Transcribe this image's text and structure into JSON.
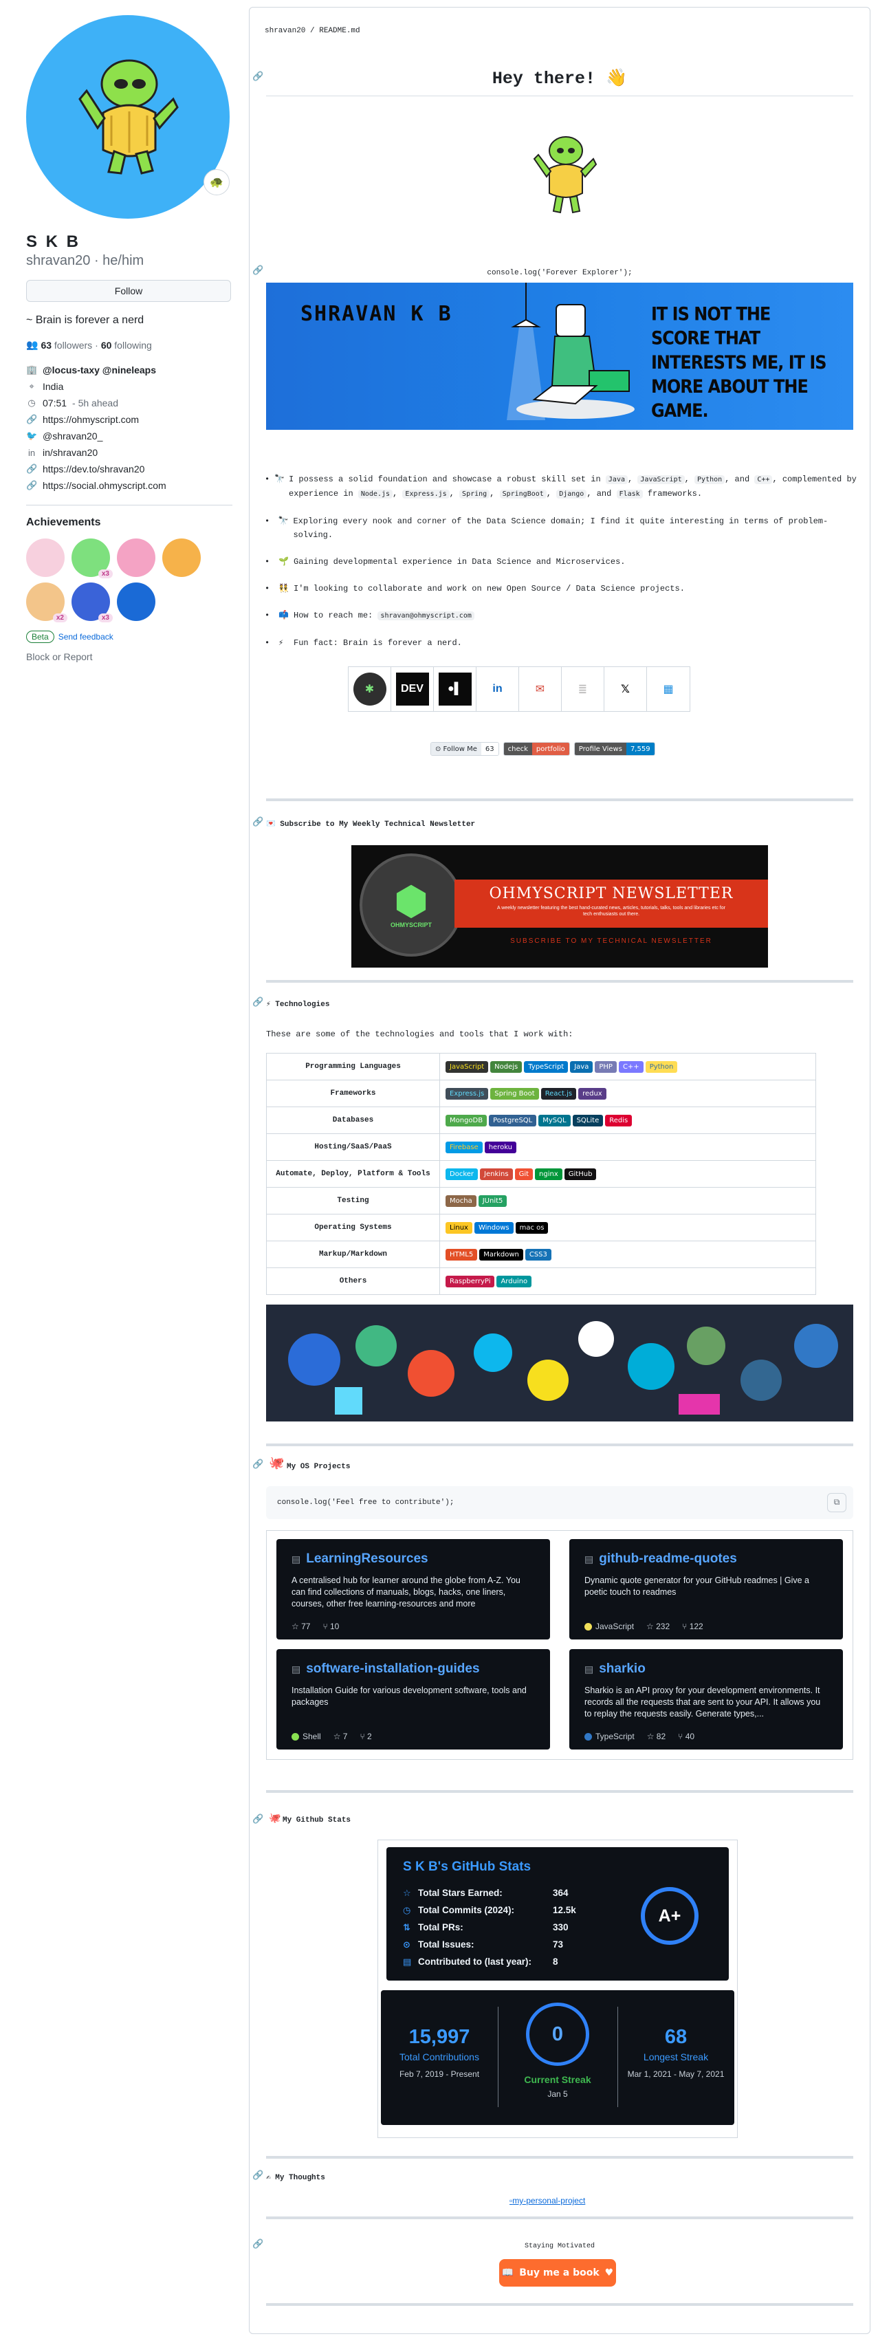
{
  "profile": {
    "fullname": "S K B",
    "handle": "shravan20",
    "pronouns": "he/him",
    "handle_line": "shravan20 · he/him",
    "status_emoji": "🐢",
    "follow_label": "Follow",
    "bio": "~ Brain is forever a nerd",
    "followers_count": "63",
    "followers_label": "followers",
    "separator": "·",
    "following_count": "60",
    "following_label": "following",
    "organizations": "@locus-taxy @nineleaps",
    "location": "India",
    "local_time": "07:51",
    "time_ahead": "- 5h ahead",
    "links": [
      {
        "icon": "link-icon",
        "text": "https://ohmyscript.com"
      },
      {
        "icon": "twitter-icon",
        "text": "@shravan20_"
      },
      {
        "icon": "linkedin-icon",
        "text": "in/shravan20"
      },
      {
        "icon": "link-icon",
        "text": "https://dev.to/shravan20"
      },
      {
        "icon": "link-icon",
        "text": "https://social.ohmyscript.com"
      }
    ],
    "achievements_title": "Achievements",
    "achievements": [
      {
        "name": "heart-on-sleeve-badge",
        "color": "#f7d0de",
        "count": ""
      },
      {
        "name": "pull-shark-badge",
        "color": "#7ee07e",
        "count": "x3"
      },
      {
        "name": "yolo-badge",
        "color": "#f4a3c4",
        "count": ""
      },
      {
        "name": "quickdraw-badge",
        "color": "#f6b24a",
        "count": ""
      },
      {
        "name": "starstruck-badge",
        "color": "#f3c58a",
        "count": "x2"
      },
      {
        "name": "galaxy-brain-badge",
        "color": "#3a63d8",
        "count": "x3"
      },
      {
        "name": "arctic-code-vault-badge",
        "color": "#1a6ad6",
        "count": ""
      }
    ],
    "beta_label": "Beta",
    "feedback_label": "Send feedback",
    "block_report_label": "Block or Report"
  },
  "readme": {
    "path": "shravan20 / README.md",
    "hello_title": "Hey there! 👋",
    "console_line": "console.log('Forever Explorer');",
    "banner_name": "SHRAVAN K B",
    "banner_quote": "IT IS NOT THE SCORE THAT INTERESTS ME, IT IS MORE ABOUT THE GAME.",
    "bio_items": [
      {
        "emoji": "🔭",
        "parts": [
          "I possess a solid foundation and showcase a robust skill set in ",
          "Java",
          ", ",
          "JavaScript",
          ", ",
          "Python",
          ", and ",
          "C++",
          ", complemented by experience in ",
          "Node.js",
          ", ",
          "Express.js",
          ", ",
          "Spring",
          ", ",
          "SpringBoot",
          ", ",
          "Django",
          ", and ",
          "Flask",
          " frameworks."
        ]
      },
      {
        "emoji": "🔭",
        "text": "Exploring every nook and corner of the Data Science domain; I find it quite interesting in terms of problem-solving."
      },
      {
        "emoji": "🌱",
        "text": "Gaining developmental experience in Data Science and Microservices."
      },
      {
        "emoji": "👯",
        "text": "I'm looking to collaborate and work on new Open Source / Data Science projects."
      },
      {
        "emoji": "📫",
        "text": "How to reach me: ",
        "code": "shravan@ohmyscript.com"
      },
      {
        "emoji": "⚡",
        "text": "Fun fact: Brain is forever a nerd."
      }
    ],
    "social_icons": [
      {
        "name": "ohmyscript-icon",
        "label": "",
        "bg": "#2f2f2f",
        "fg": "#7be37b"
      },
      {
        "name": "dev-icon",
        "label": "DEV",
        "bg": "#0a0a0a",
        "fg": "#ffffff"
      },
      {
        "name": "medium-icon",
        "label": "●▌",
        "bg": "#0a0a0a",
        "fg": "#ffffff"
      },
      {
        "name": "linkedin-icon",
        "label": "in",
        "bg": "#ffffff",
        "fg": "#0a66c2"
      },
      {
        "name": "gmail-icon",
        "label": "✉",
        "bg": "#ffffff",
        "fg": "#d44638"
      },
      {
        "name": "stackoverflow-icon",
        "label": "≣",
        "bg": "#ffffff",
        "fg": "#bcbbbb"
      },
      {
        "name": "x-icon",
        "label": "𝕏",
        "bg": "#ffffff",
        "fg": "#000000"
      },
      {
        "name": "calendar-icon",
        "label": "▦",
        "bg": "#ffffff",
        "fg": "#1f8fe0"
      }
    ],
    "shields": [
      {
        "name": "follow-shield",
        "left": "⊙ Follow Me",
        "right": "63",
        "lbg": "#eaeef2",
        "lfg": "#24292f",
        "rbg": "#ffffff",
        "rfg": "#24292f"
      },
      {
        "name": "portfolio-shield",
        "left": "check",
        "right": "portfolio",
        "lbg": "#555555",
        "lfg": "#ffffff",
        "rbg": "#e05d44",
        "rfg": "#ffffff"
      },
      {
        "name": "profile-views-shield",
        "left": "Profile Views",
        "right": "7,559",
        "lbg": "#555555",
        "lfg": "#ffffff",
        "rbg": "#007ec6",
        "rfg": "#ffffff"
      }
    ],
    "newsletter_heading": "💌 Subscribe to My Weekly Technical Newsletter",
    "newsletter_title": "OHMYSCRIPT NEWSLETTER",
    "newsletter_desc": "A weekly newsletter featuring the best hand-curated news, articles, tutorials, talks, tools and libraries etc for tech enthusiasts out there.",
    "newsletter_cta": "SUBSCRIBE TO MY TECHNICAL NEWSLETTER",
    "newsletter_logo_text": "OHMYSCRIPT",
    "technologies_heading": "⚡ Technologies",
    "technologies_intro": "These are some of the technologies and tools that I work with:",
    "tech_rows": [
      {
        "category": "Programming Languages",
        "items": [
          {
            "t": "JavaScript",
            "bg": "#323330",
            "fg": "#f7df1e"
          },
          {
            "t": "Nodejs",
            "bg": "#43853d",
            "fg": "#ffffff"
          },
          {
            "t": "TypeScript",
            "bg": "#007acc",
            "fg": "#ffffff"
          },
          {
            "t": "Java",
            "bg": "#0b6fb1",
            "fg": "#ffffff"
          },
          {
            "t": "PHP",
            "bg": "#777bb4",
            "fg": "#ffffff"
          },
          {
            "t": "C++",
            "bg": "#7b79ff",
            "fg": "#ffffff"
          },
          {
            "t": "Python",
            "bg": "#ffdd54",
            "fg": "#3670a0"
          }
        ]
      },
      {
        "category": "Frameworks",
        "items": [
          {
            "t": "Express.js",
            "bg": "#404d59",
            "fg": "#61dafb"
          },
          {
            "t": "Spring Boot",
            "bg": "#6db33f",
            "fg": "#ffffff"
          },
          {
            "t": "React.js",
            "bg": "#20232a",
            "fg": "#61dafb"
          },
          {
            "t": "redux",
            "bg": "#593d88",
            "fg": "#ffffff"
          }
        ]
      },
      {
        "category": "Databases",
        "items": [
          {
            "t": "MongoDB",
            "bg": "#4ea94b",
            "fg": "#ffffff"
          },
          {
            "t": "PostgreSQL",
            "bg": "#316192",
            "fg": "#ffffff"
          },
          {
            "t": "MySQL",
            "bg": "#00758f",
            "fg": "#ffffff"
          },
          {
            "t": "SQLite",
            "bg": "#07405e",
            "fg": "#ffffff"
          },
          {
            "t": "Redis",
            "bg": "#dd0031",
            "fg": "#ffffff"
          }
        ]
      },
      {
        "category": "Hosting/SaaS/PaaS",
        "items": [
          {
            "t": "Firebase",
            "bg": "#039be5",
            "fg": "#ffca28"
          },
          {
            "t": "heroku",
            "bg": "#430098",
            "fg": "#ffffff"
          }
        ]
      },
      {
        "category": "Automate, Deploy, Platform & Tools",
        "items": [
          {
            "t": "Docker",
            "bg": "#0db7ed",
            "fg": "#ffffff"
          },
          {
            "t": "Jenkins",
            "bg": "#d24939",
            "fg": "#ffffff"
          },
          {
            "t": "Git",
            "bg": "#f05033",
            "fg": "#ffffff"
          },
          {
            "t": "nginx",
            "bg": "#009639",
            "fg": "#ffffff"
          },
          {
            "t": "GitHub",
            "bg": "#121011",
            "fg": "#ffffff"
          }
        ]
      },
      {
        "category": "Testing",
        "items": [
          {
            "t": "Mocha",
            "bg": "#8d6748",
            "fg": "#ffffff"
          },
          {
            "t": "JUnit5",
            "bg": "#25a162",
            "fg": "#ffffff"
          }
        ]
      },
      {
        "category": "Operating Systems",
        "items": [
          {
            "t": "Linux",
            "bg": "#fcc624",
            "fg": "#000000"
          },
          {
            "t": "Windows",
            "bg": "#0078d6",
            "fg": "#ffffff"
          },
          {
            "t": "mac os",
            "bg": "#000000",
            "fg": "#f0f0f0"
          }
        ]
      },
      {
        "category": "Markup/Markdown",
        "items": [
          {
            "t": "HTML5",
            "bg": "#e34f26",
            "fg": "#ffffff"
          },
          {
            "t": "Markdown",
            "bg": "#000000",
            "fg": "#ffffff"
          },
          {
            "t": "CSS3",
            "bg": "#1572b6",
            "fg": "#ffffff"
          }
        ]
      },
      {
        "category": "Others",
        "items": [
          {
            "t": "RaspberryPi",
            "bg": "#c51a4a",
            "fg": "#ffffff"
          },
          {
            "t": "Arduino",
            "bg": "#00979d",
            "fg": "#ffffff"
          }
        ]
      }
    ],
    "os_heading": "My OS Projects",
    "os_console": "console.log('Feel free to contribute');",
    "repos": [
      {
        "title": "LearningResources",
        "desc": "A centralised hub for learner around the globe from A-Z. You can find collections of manuals, blogs, hacks, one liners, courses, other free learning-resources and more",
        "lang": "",
        "lang_color": "",
        "stars": "77",
        "forks": "10"
      },
      {
        "title": "github-readme-quotes",
        "desc": "Dynamic quote generator for your GitHub readmes | Give a poetic touch to readmes",
        "lang": "JavaScript",
        "lang_color": "#f1e05a",
        "stars": "232",
        "forks": "122"
      },
      {
        "title": "software-installation-guides",
        "desc": "Installation Guide for various development software, tools and packages",
        "lang": "Shell",
        "lang_color": "#89e051",
        "stars": "7",
        "forks": "2"
      },
      {
        "title": "sharkio",
        "desc": "Sharkio is an API proxy for your development environments. It records all the requests that are sent to your API. It allows you to replay the requests easily. Generate types,...",
        "lang": "TypeScript",
        "lang_color": "#3178c6",
        "stars": "82",
        "forks": "40"
      }
    ],
    "stats_heading": "My Github Stats",
    "stats_title": "S K B's GitHub Stats",
    "stats": [
      {
        "icon": "star-icon",
        "glyph": "☆",
        "label": "Total Stars Earned:",
        "value": "364"
      },
      {
        "icon": "clock-icon",
        "glyph": "◷",
        "label": "Total Commits (2024):",
        "value": "12.5k"
      },
      {
        "icon": "pull-request-icon",
        "glyph": "⇅",
        "label": "Total PRs:",
        "value": "330"
      },
      {
        "icon": "issue-icon",
        "glyph": "⊙",
        "label": "Total Issues:",
        "value": "73"
      },
      {
        "icon": "repo-icon",
        "glyph": "▤",
        "label": "Contributed to (last year):",
        "value": "8"
      }
    ],
    "grade": "A+",
    "streak": {
      "total": "15,997",
      "total_label": "Total Contributions",
      "total_range": "Feb 7, 2019 - Present",
      "current": "0",
      "current_label": "Current Streak",
      "current_date": "Jan 5",
      "longest": "68",
      "longest_label": "Longest Streak",
      "longest_range": "Mar 1, 2021 - May 7, 2021"
    },
    "thoughts_heading": "My Thoughts",
    "thoughts_alt": "my-personal-project",
    "motivated_title": "Staying Motivated",
    "bmac_label": "Buy me a book"
  }
}
